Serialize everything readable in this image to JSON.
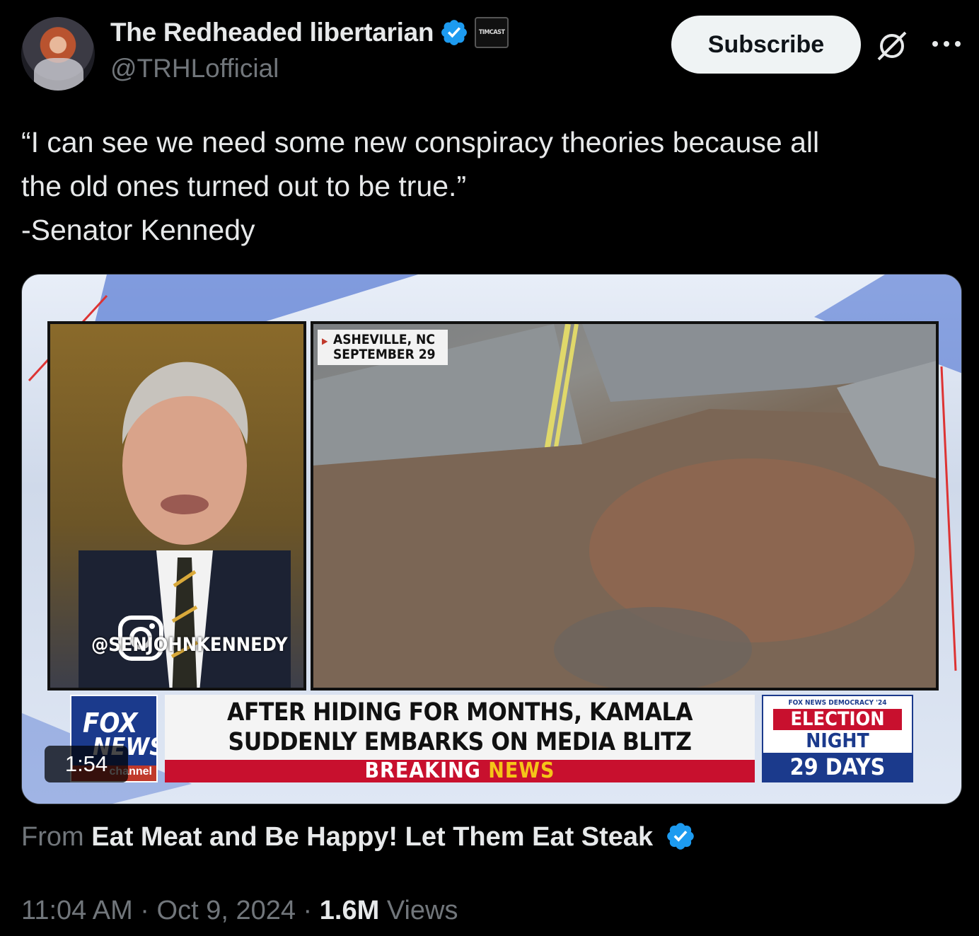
{
  "author": {
    "display_name": "The Redheaded libertarian",
    "handle": "@TRHLofficial",
    "affiliate_badge": "TIMCAST",
    "avatar_icon": "avatar-photo"
  },
  "actions": {
    "subscribe_label": "Subscribe",
    "grok_icon": "grok-icon",
    "more_icon": "more-dots-icon"
  },
  "tweet": {
    "lines": [
      "“I can see we need some new conspiracy theories because all",
      "the old ones turned out to be true.”",
      "-Senator Kennedy"
    ]
  },
  "video": {
    "duration": "1:54",
    "location_line1": "ASHEVILLE, NC",
    "location_line2": "SEPTEMBER 29",
    "instagram_handle": "@SENJOHNKENNEDY",
    "headline_line1": "AFTER HIDING FOR MONTHS, KAMALA",
    "headline_line2": "SUDDENLY EMBARKS ON MEDIA BLITZ",
    "breaking_word1": "BREAKING",
    "breaking_word2": "NEWS",
    "network_fox": "FOX",
    "network_news": "NEWS",
    "network_channel": "channel",
    "election_top": "FOX NEWS DEMOCRACY '24",
    "election_word1": "ELECTION",
    "election_word2": "NIGHT",
    "election_days": "29 DAYS"
  },
  "source": {
    "prefix": "From",
    "name": "Eat Meat and Be Happy! Let Them Eat Steak"
  },
  "meta": {
    "time": "11:04 AM",
    "date": "Oct 9, 2024",
    "views_count": "1.6M",
    "views_label": "Views"
  },
  "colors": {
    "background": "#000000",
    "verified_blue": "#1d9bf0",
    "muted_text": "#71767b",
    "fox_blue": "#1b3a8c",
    "breaking_red": "#c8102e"
  }
}
